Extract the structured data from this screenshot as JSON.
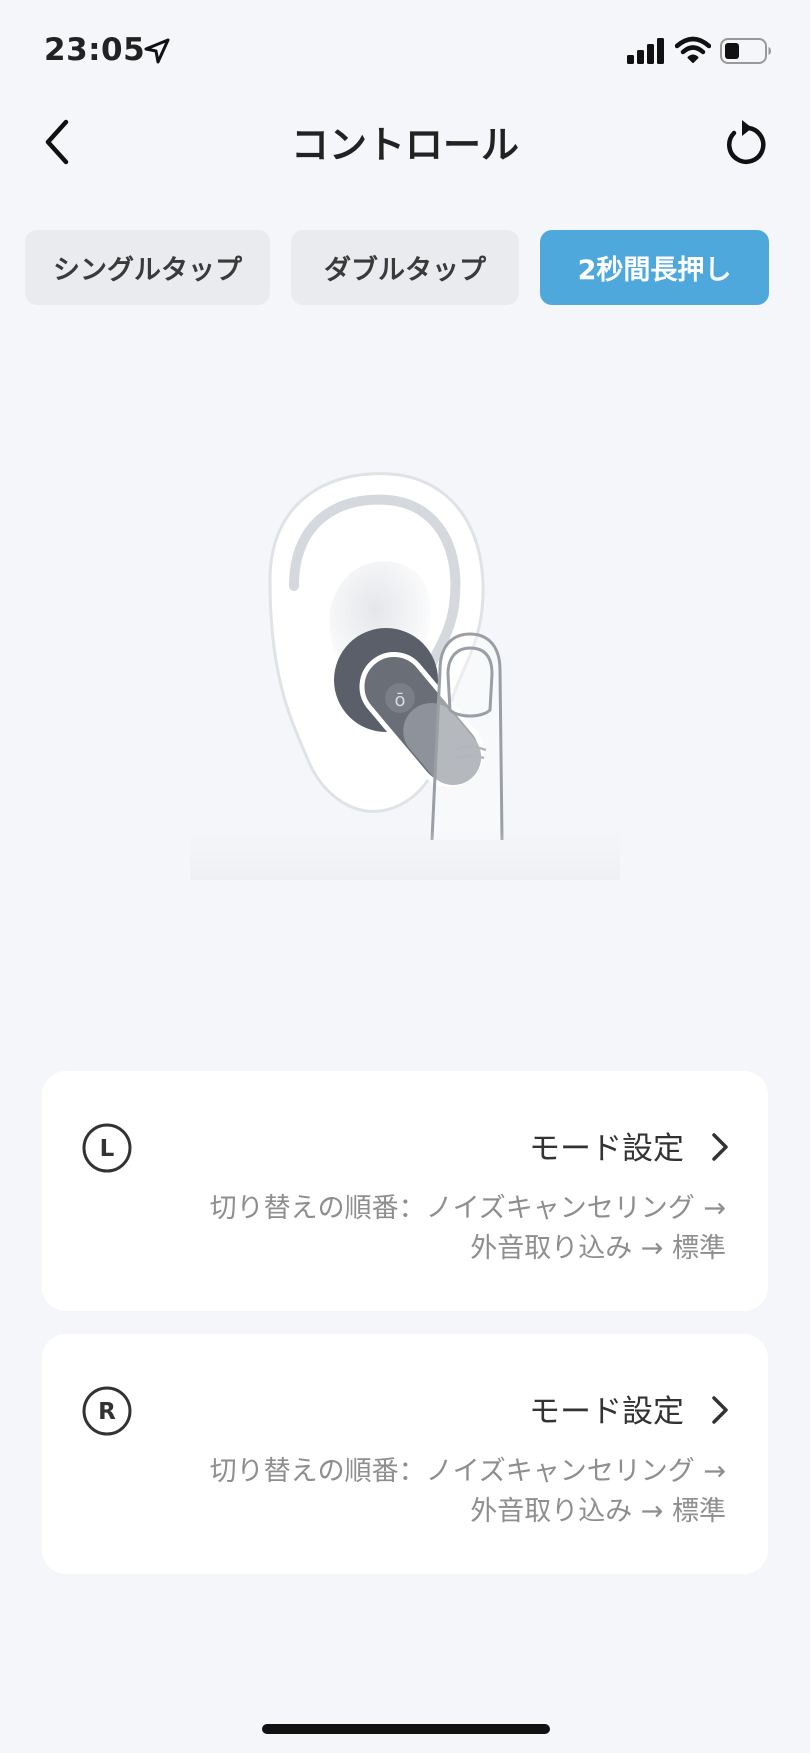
{
  "status_bar": {
    "time": "23:05"
  },
  "header": {
    "title": "コントロール"
  },
  "tabs": [
    {
      "label": "シングルタップ",
      "active": false
    },
    {
      "label": "ダブルタップ",
      "active": false
    },
    {
      "label": "2秒間長押し",
      "active": true
    }
  ],
  "cards": [
    {
      "side": "L",
      "mode_label": "モード設定",
      "order_line1": "切り替えの順番：ノイズキャンセリング →",
      "order_line2": "外音取り込み → 標準"
    },
    {
      "side": "R",
      "mode_label": "モード設定",
      "order_line1": "切り替えの順番：ノイズキャンセリング →",
      "order_line2": "外音取り込み → 標準"
    }
  ],
  "colors": {
    "accent": "#4ea8dc",
    "background": "#f4f6f9",
    "tab_inactive": "#e9ebee",
    "secondary_text": "#8e8e8e",
    "earbud": "#5b5f69"
  },
  "icons": {
    "back": "chevron-left-icon",
    "reset": "reset-icon",
    "location": "location-arrow-icon",
    "signal": "cellular-signal-icon",
    "wifi": "wifi-icon",
    "battery": "battery-icon",
    "card_chevron": "chevron-right-icon"
  }
}
